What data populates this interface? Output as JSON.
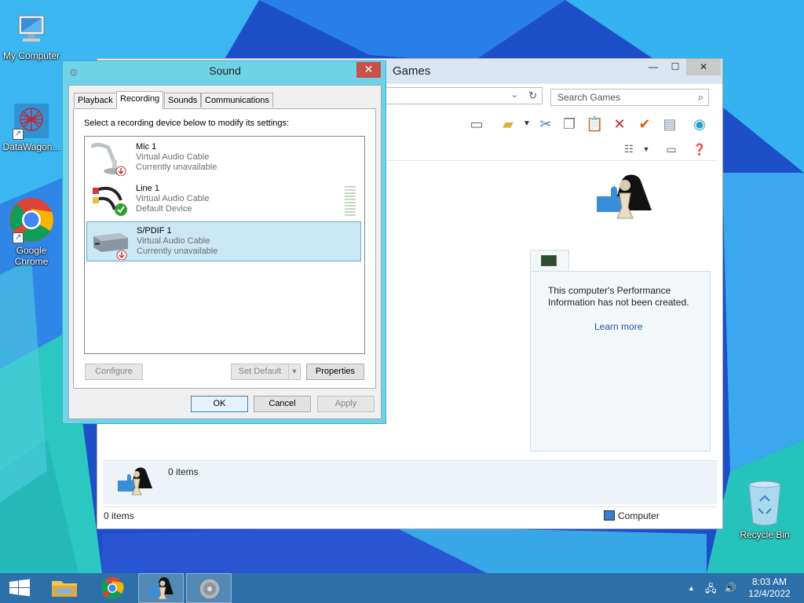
{
  "colors": {
    "dialog_frame": "#6fd3e8",
    "close_button": "#c7504a",
    "taskbar": "#2d6fa8",
    "selection": "#cce8f4",
    "link": "#1a56a8"
  },
  "desktop": {
    "icons": [
      {
        "label": "My Computer",
        "icon": "computer-icon"
      },
      {
        "label": "DataWagon...",
        "icon": "datawagon-icon"
      },
      {
        "label": "Google Chrome",
        "icon": "chrome-icon"
      },
      {
        "label": "Recycle Bin",
        "icon": "recycle-bin-icon"
      }
    ]
  },
  "explorer": {
    "title": "Games",
    "search_placeholder": "Search Games",
    "performance_text": "This computer's Performance Information has not been created.",
    "learn_more": "Learn more",
    "details_count": "0 items",
    "status_count": "0 items",
    "status_location": "Computer"
  },
  "sound": {
    "title": "Sound",
    "tabs": [
      "Playback",
      "Recording",
      "Sounds",
      "Communications"
    ],
    "active_tab": "Recording",
    "instruction": "Select a recording device below to modify its settings:",
    "devices": [
      {
        "name": "Mic 1",
        "driver": "Virtual Audio Cable",
        "status": "Currently unavailable"
      },
      {
        "name": "Line 1",
        "driver": "Virtual Audio Cable",
        "status": "Default Device"
      },
      {
        "name": "S/PDIF 1",
        "driver": "Virtual Audio Cable",
        "status": "Currently unavailable"
      }
    ],
    "buttons": {
      "configure": "Configure",
      "set_default": "Set Default",
      "properties": "Properties",
      "ok": "OK",
      "cancel": "Cancel",
      "apply": "Apply"
    }
  },
  "taskbar": {
    "time": "8:03 AM",
    "date": "12/4/2022"
  }
}
